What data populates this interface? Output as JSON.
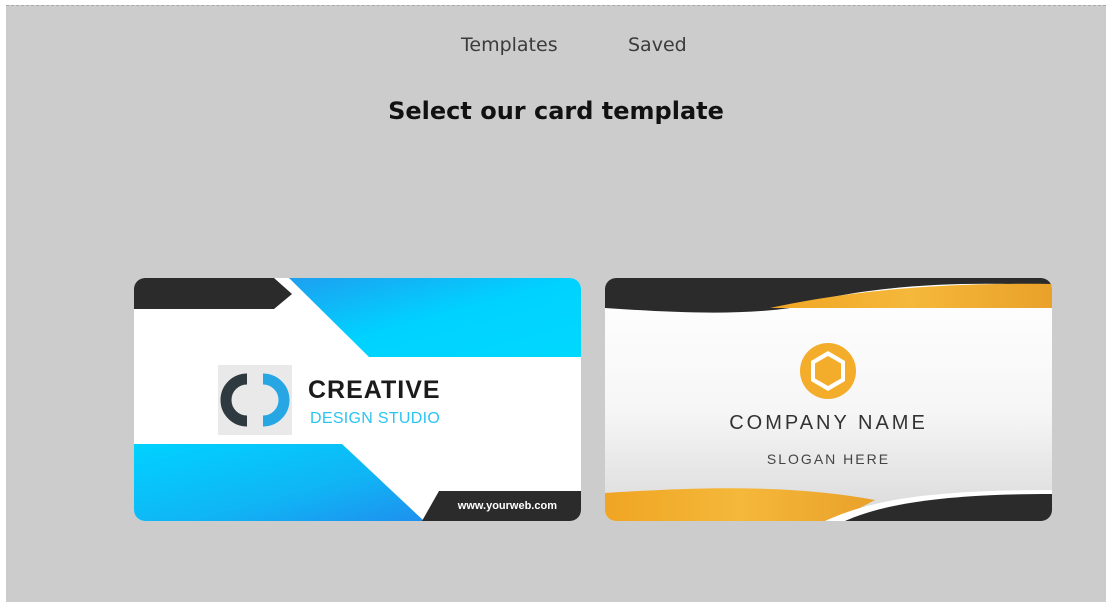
{
  "tabs": {
    "templates": "Templates",
    "saved": "Saved"
  },
  "page": {
    "title": "Select our card template"
  },
  "cards": [
    {
      "company": "CREATIVE",
      "subtitle": "DESIGN STUDIO",
      "website": "www.yourweb.com",
      "logo_icon": "ring-logo-icon",
      "colors": {
        "accent": "#00d2ff",
        "dark": "#2b2b2b"
      }
    },
    {
      "company": "COMPANY NAME",
      "slogan": "SLOGAN HERE",
      "logo_icon": "hexagon-logo-icon",
      "colors": {
        "accent": "#f2b233",
        "dark": "#2b2b2b"
      }
    }
  ]
}
